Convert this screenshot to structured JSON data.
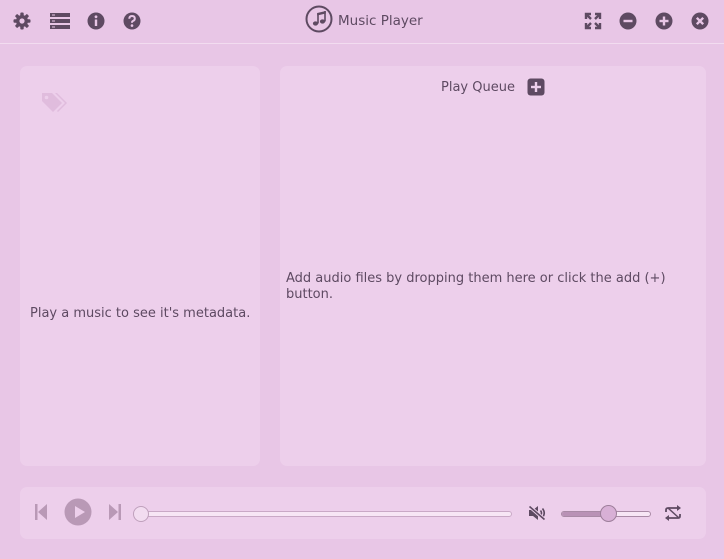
{
  "app": {
    "title": "Music Player",
    "icon": "music-note-icon"
  },
  "titlebar": {
    "left_icons": [
      "gear-icon",
      "playlist-icon",
      "info-icon",
      "help-icon"
    ],
    "right_icons": [
      "fullscreen-icon",
      "minimize-icon",
      "maximize-icon",
      "close-icon"
    ]
  },
  "metadata_panel": {
    "icon": "tags-icon",
    "empty_text": "Play a music to see it's metadata."
  },
  "queue_panel": {
    "title": "Play Queue",
    "add_icon": "add-square-icon",
    "empty_text": "Add audio files by dropping them here or click the add (+) button."
  },
  "controls": {
    "icons": [
      "skip-previous-icon",
      "play-icon",
      "skip-next-icon",
      "volume-muted-icon",
      "repeat-icon"
    ],
    "progress": 0,
    "volume": 0.52
  },
  "colors": {
    "background": "#e8c6e6",
    "panel": "#edcfeb",
    "text": "#5e4a62",
    "icon_dim": "#b999b6"
  }
}
